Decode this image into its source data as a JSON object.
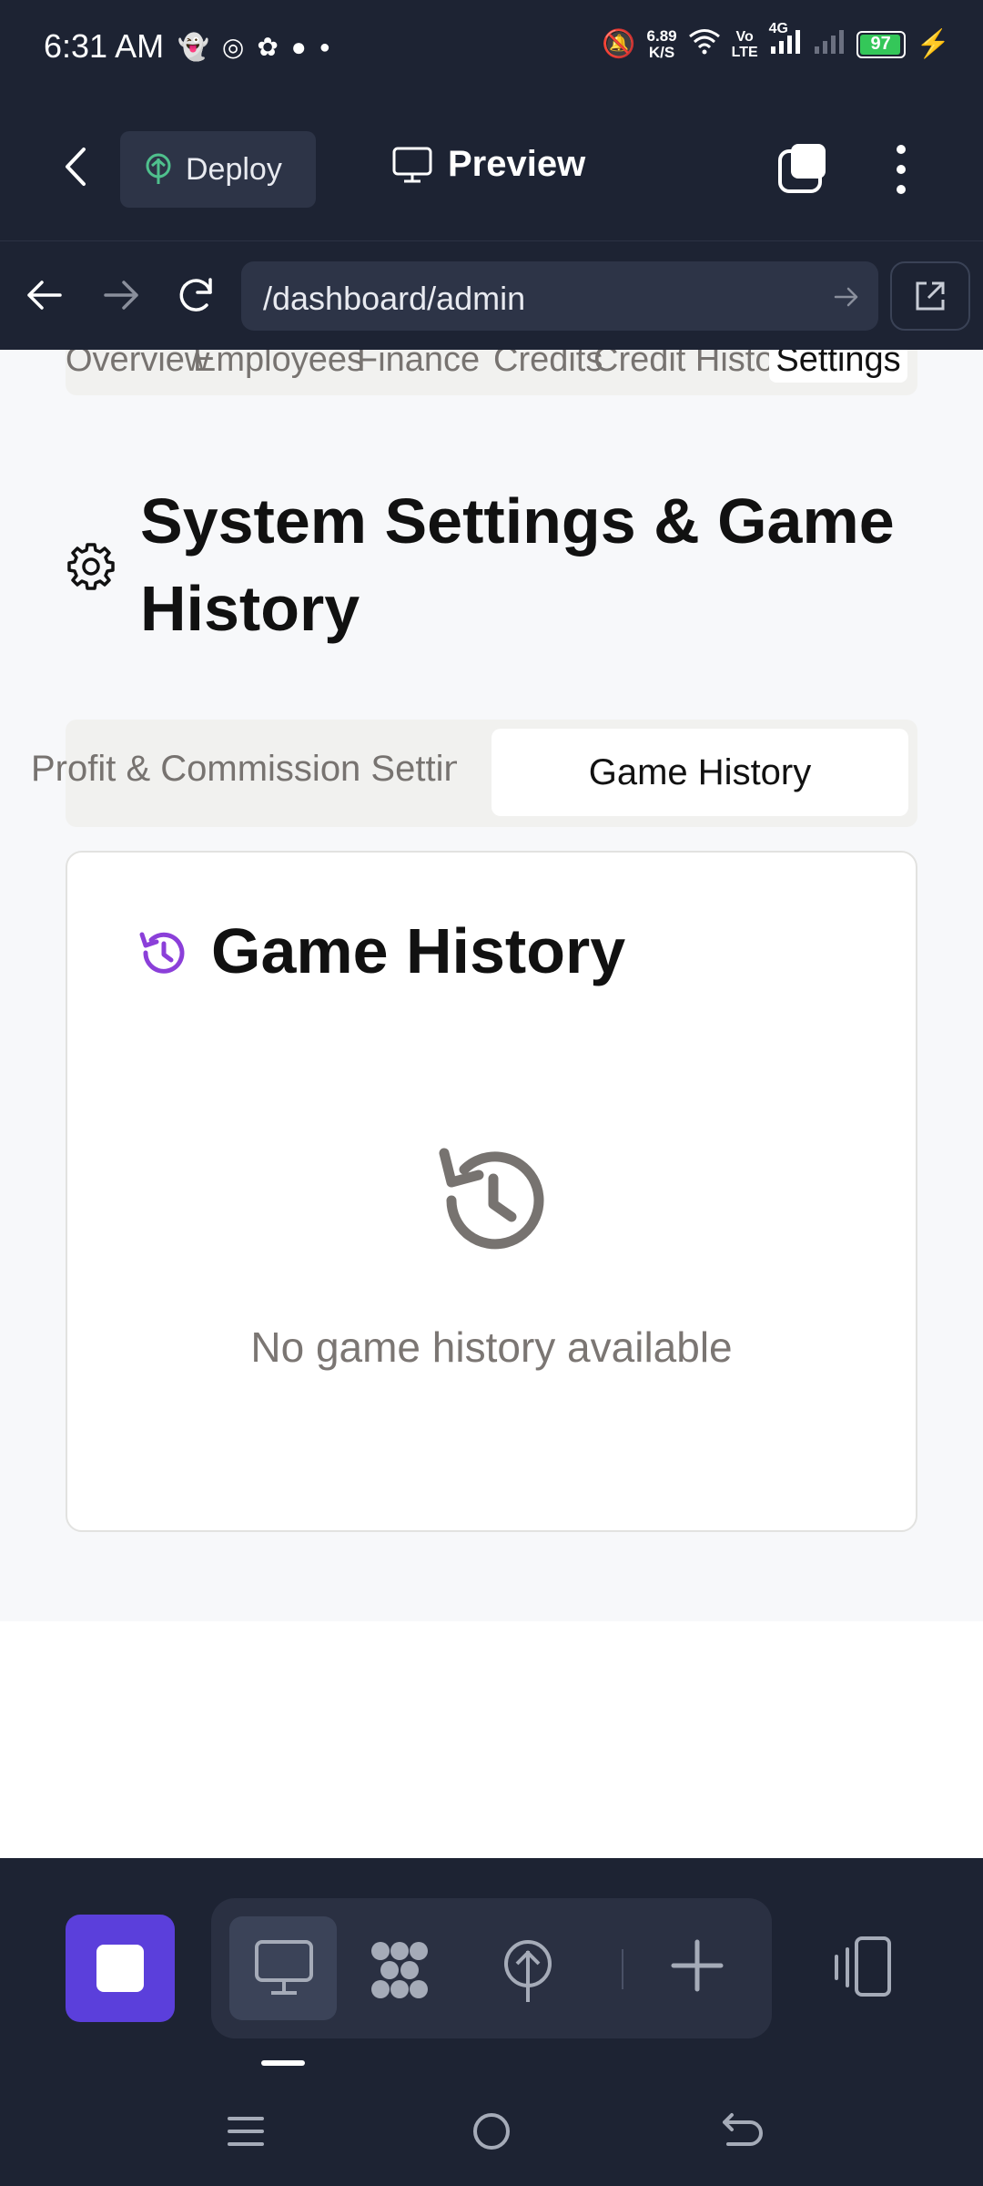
{
  "status_bar": {
    "time": "6:31 AM",
    "net_speed_value": "6.89",
    "net_speed_unit": "K/S",
    "volte_top": "Vo",
    "volte_bottom": "LTE",
    "network_type": "4G",
    "battery_percent": "97",
    "battery_level": 0.97,
    "notification_icons": [
      "snapchat-icon",
      "instagram-icon",
      "chatgpt-icon",
      "piggy-icon",
      "dot-icon"
    ]
  },
  "toolbar": {
    "deploy_label": "Deploy",
    "preview_label": "Preview"
  },
  "browser": {
    "url": "/dashboard/admin"
  },
  "top_tabs": [
    "Overview",
    "Employees",
    "Finance",
    "Credits",
    "Credit History",
    "Settings"
  ],
  "top_tabs_active": "Settings",
  "page": {
    "title": "System Settings & Game History"
  },
  "sub_tabs": {
    "inactive": "Profit & Commission Settings",
    "active": "Game History"
  },
  "card": {
    "title": "Game History",
    "empty_message": "No game history available"
  },
  "colors": {
    "dark_bg": "#1d2333",
    "accent_purple": "#5b3fdb",
    "history_icon_purple": "#8b3fd9",
    "deploy_green": "#4fc08d"
  }
}
